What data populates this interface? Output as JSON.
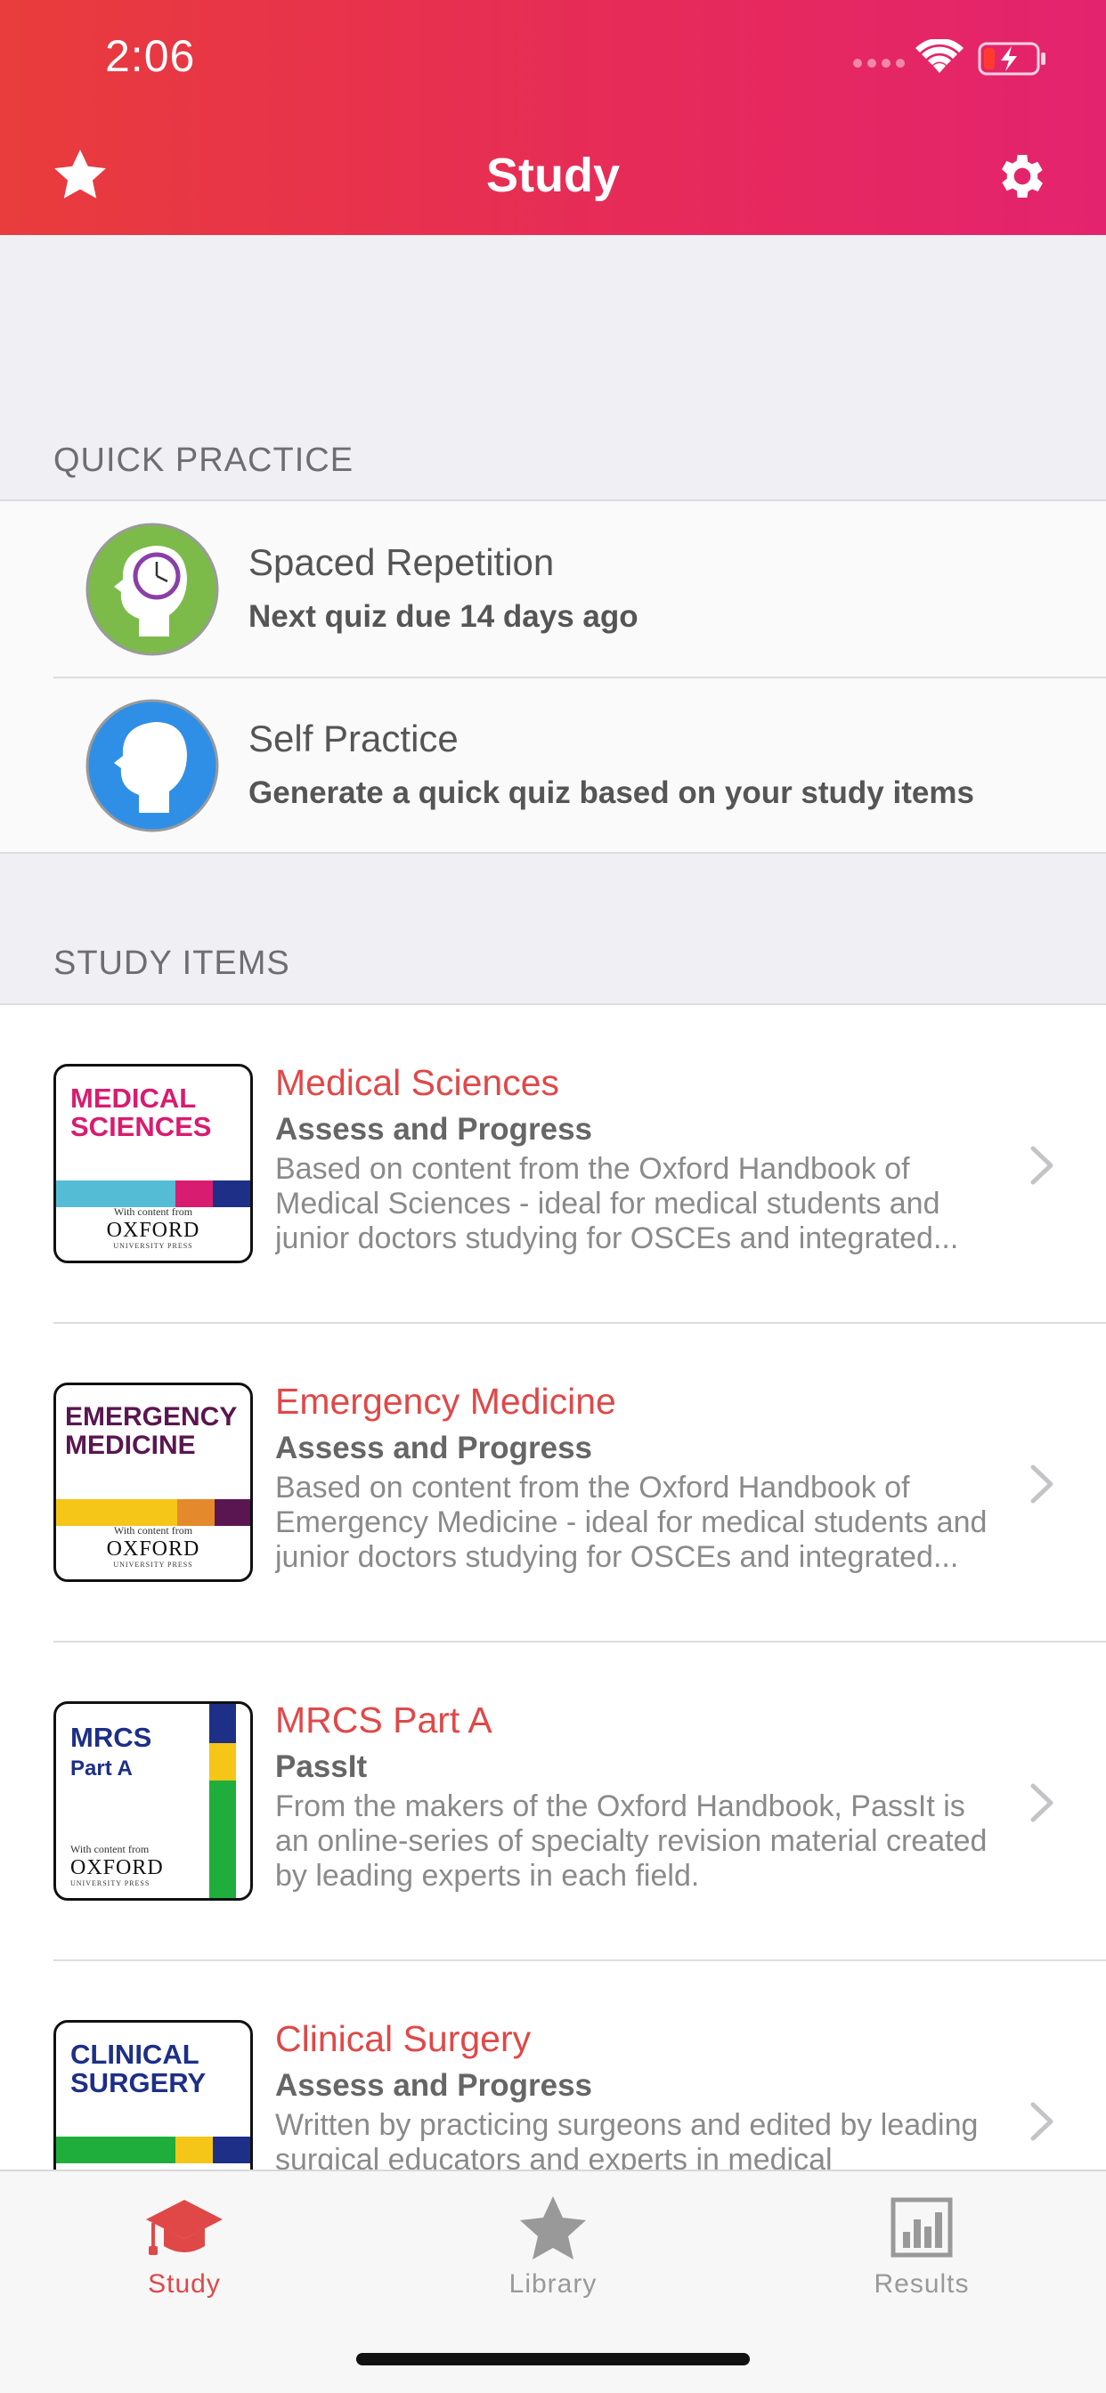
{
  "status_bar": {
    "time": "2:06"
  },
  "nav": {
    "title": "Study"
  },
  "quick_practice": {
    "header": "QUICK PRACTICE",
    "items": [
      {
        "title": "Spaced Repetition",
        "subtitle": "Next quiz due 14 days ago",
        "icon": "clock-head-icon",
        "color": "#7cbb4a"
      },
      {
        "title": "Self Practice",
        "subtitle": "Generate a quick quiz based on your study items",
        "icon": "head-icon",
        "color": "#2f8fe6"
      }
    ]
  },
  "study_items": {
    "header": "STUDY ITEMS",
    "items": [
      {
        "title": "Medical Sciences",
        "subtitle": "Assess and Progress",
        "description": "Based on content from the Oxford Handbook of Medical Sciences - ideal for medical students and junior doctors studying for OSCEs and integrated...",
        "cover": {
          "line1": "MEDICAL",
          "line2": "SCIENCES",
          "text_color": "#d81c6f",
          "footer_small": "With content from",
          "footer_brand": "OXFORD",
          "footer_press": "UNIVERSITY PRESS"
        }
      },
      {
        "title": "Emergency Medicine",
        "subtitle": "Assess and Progress",
        "description": "Based on content from the Oxford Handbook of Emergency Medicine - ideal for medical students and junior doctors studying for OSCEs and integrated...",
        "cover": {
          "line1": "EMERGENCY",
          "line2": "MEDICINE",
          "text_color": "#5a1650",
          "footer_small": "With content from",
          "footer_brand": "OXFORD",
          "footer_press": "UNIVERSITY PRESS"
        }
      },
      {
        "title": "MRCS Part A",
        "subtitle": "PassIt",
        "description": "From the makers of the Oxford Handbook, PassIt is an online-series of specialty revision material created by leading experts in each field.",
        "cover": {
          "line1": "MRCS",
          "line2": "Part A",
          "text_color": "#1d2f86",
          "footer_small": "With content from",
          "footer_brand": "OXFORD",
          "footer_press": "UNIVERSITY PRESS"
        }
      },
      {
        "title": "Clinical Surgery",
        "subtitle": "Assess and Progress",
        "description": "Written by practicing surgeons and edited by leading surgical educators and experts in medical education...",
        "cover": {
          "line1": "CLINICAL",
          "line2": "SURGERY",
          "text_color": "#1d2f86"
        }
      }
    ]
  },
  "tabbar": {
    "tabs": [
      {
        "label": "Study",
        "icon": "graduation-cap-icon",
        "active": true
      },
      {
        "label": "Library",
        "icon": "star-icon",
        "active": false
      },
      {
        "label": "Results",
        "icon": "bar-chart-icon",
        "active": false
      }
    ]
  },
  "colors": {
    "accent": "#e04848",
    "header_start": "#e93c3c",
    "header_end": "#e4236e"
  }
}
